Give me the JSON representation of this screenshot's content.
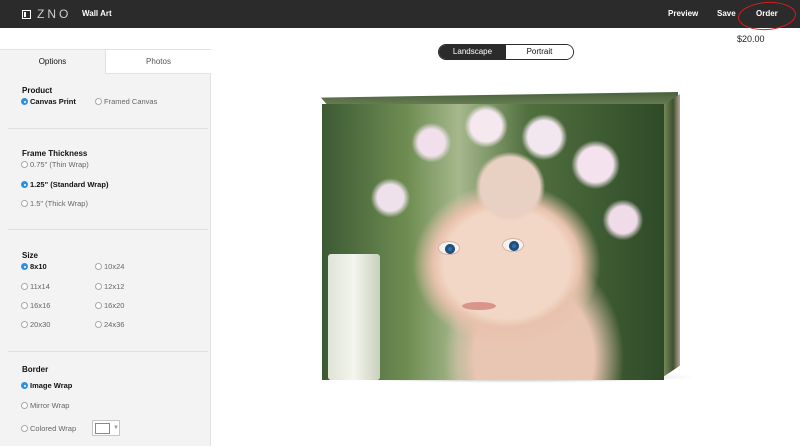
{
  "header": {
    "logo_text": "ZNO",
    "app_title": "Wall Art",
    "actions": {
      "preview": "Preview",
      "save": "Save",
      "order": "Order"
    },
    "price": "$20.00"
  },
  "sidebar": {
    "tabs": [
      "Options",
      "Photos"
    ],
    "product": {
      "title": "Product",
      "options": [
        {
          "label": "Canvas Print",
          "selected": true
        },
        {
          "label": "Framed Canvas",
          "selected": false
        }
      ]
    },
    "frame_thickness": {
      "title": "Frame Thickness",
      "options": [
        {
          "label": "0.75\" (Thin Wrap)",
          "selected": false
        },
        {
          "label": "1.25\" (Standard Wrap)",
          "selected": true
        },
        {
          "label": "1.5\" (Thick Wrap)",
          "selected": false
        }
      ]
    },
    "size": {
      "title": "Size",
      "options": [
        {
          "label": "8x10",
          "selected": true
        },
        {
          "label": "10x24",
          "selected": false
        },
        {
          "label": "11x14",
          "selected": false
        },
        {
          "label": "12x12",
          "selected": false
        },
        {
          "label": "16x16",
          "selected": false
        },
        {
          "label": "16x20",
          "selected": false
        },
        {
          "label": "20x30",
          "selected": false
        },
        {
          "label": "24x36",
          "selected": false
        }
      ]
    },
    "border": {
      "title": "Border",
      "options": [
        {
          "label": "Image Wrap",
          "selected": true
        },
        {
          "label": "Mirror Wrap",
          "selected": false
        },
        {
          "label": "Colored Wrap",
          "selected": false
        }
      ]
    }
  },
  "orientation": {
    "options": [
      "Landscape",
      "Portrait"
    ],
    "selected": "Landscape"
  },
  "colors": {
    "topbar": "#2b2b2b",
    "accent_radio": "#2f8fe0",
    "annotation_circle": "#d21e1e"
  },
  "icons": {
    "logo": "zno-logo-icon",
    "swatch_dropdown": "chevron-down-icon"
  }
}
